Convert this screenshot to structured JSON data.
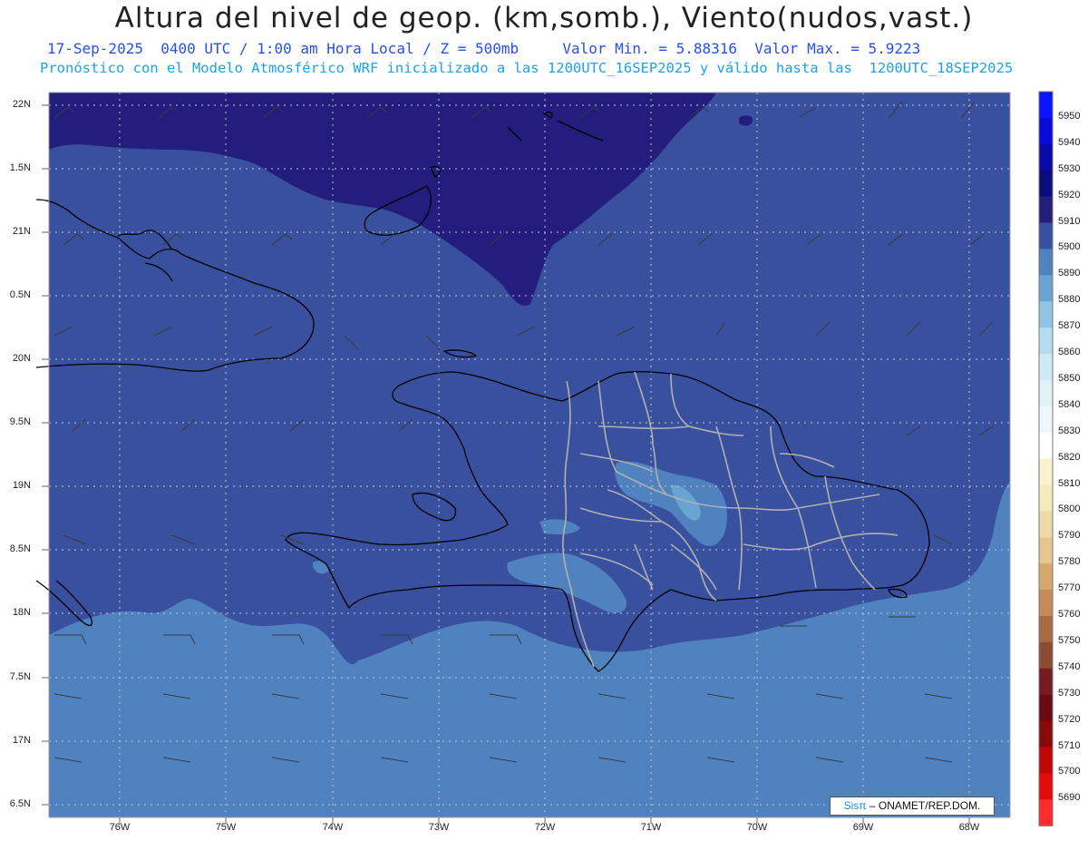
{
  "header": {
    "title": "Altura del nivel de geop. (km,somb.), Viento(nudos,vast.)",
    "subtitle_left": "17-Sep-2025  0400 UTC / 1:00 am Hora Local / Z = 500mb",
    "subtitle_right": "Valor Min. = 5.88316  Valor Max. = 5.9223",
    "subtitle_2": "Pronóstico con el Modelo Atmosférico WRF inicializado a las 1200UTC_16SEP2025 y válido hasta las  1200UTC_18SEP2025"
  },
  "axes": {
    "lat_labels": [
      "22N",
      "1.5N",
      "21N",
      "0.5N",
      "20N",
      "9.5N",
      "19N",
      "8.5N",
      "18N",
      "7.5N",
      "17N",
      "6.5N"
    ],
    "lon_labels": [
      "76W",
      "75W",
      "74W",
      "73W",
      "72W",
      "71W",
      "70W",
      "69W",
      "68W"
    ]
  },
  "colorbar": {
    "labels": [
      "5950",
      "5940",
      "5930",
      "5920",
      "5910",
      "5900",
      "5890",
      "5880",
      "5870",
      "5860",
      "5850",
      "5840",
      "5830",
      "5820",
      "5810",
      "5800",
      "5790",
      "5780",
      "5770",
      "5760",
      "5750",
      "5740",
      "5730",
      "5720",
      "5710",
      "5700",
      "5690"
    ],
    "colors": [
      "#0a14ff",
      "#0a0ad8",
      "#0a0aa8",
      "#0b0b7e",
      "#231e7d",
      "#38509e",
      "#4f82be",
      "#6aa4d2",
      "#90c4e2",
      "#b4dcee",
      "#cfeaf5",
      "#e0f2f8",
      "#eef8fc",
      "#ffffff",
      "#faf2cc",
      "#f6e9bc",
      "#eed9a8",
      "#e6c690",
      "#d6a86e",
      "#c48a58",
      "#a86a44",
      "#8e4a32",
      "#781a22",
      "#6a0a12",
      "#8a0a0a",
      "#c00606",
      "#e60a0a",
      "#ff2a2a"
    ]
  },
  "credit": {
    "logo": "Sisπ",
    "text": "– ONAMET/REP.DOM."
  },
  "map_colors": {
    "ocean_dark": "#231e7d",
    "main": "#38509e",
    "light": "#4f82be",
    "lighter": "#6aa4d2",
    "coast": "#000000",
    "border": "#b0b0b0"
  }
}
